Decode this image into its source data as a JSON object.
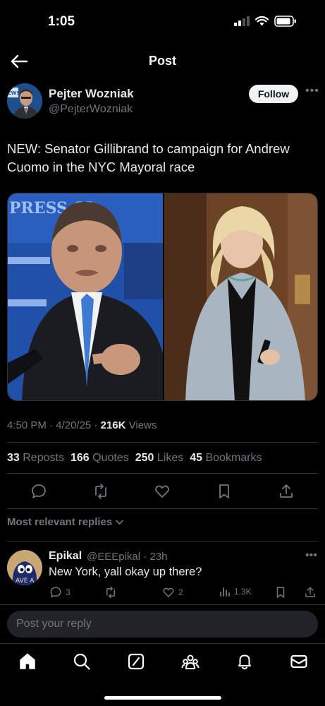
{
  "status_bar": {
    "time": "1:05"
  },
  "header": {
    "title": "Post"
  },
  "tweet": {
    "author_name": "Pejter Wozniak",
    "author_handle": "@PejterWozniak",
    "follow_label": "Follow",
    "text": "NEW: Senator Gillibrand to campaign for Andrew Cuomo in the NYC Mayoral race",
    "time": "4:50 PM",
    "date": "4/20/25",
    "views_count": "216K",
    "views_label": "Views",
    "avatar_text": "EWS",
    "media_left_text": "PRESS CL",
    "stats": {
      "reposts": "33",
      "reposts_label": "Reposts",
      "quotes": "166",
      "quotes_label": "Quotes",
      "likes": "250",
      "likes_label": "Likes",
      "bookmarks": "45",
      "bookmarks_label": "Bookmarks"
    }
  },
  "replies_filter": "Most relevant replies",
  "reply": {
    "name": "Epikal",
    "handle": "@EEEpikal",
    "age": "23h",
    "text": "New York, yall okay up there?",
    "avatar_text": "AVE A",
    "replies": "3",
    "likes": "2",
    "views": "1.3K"
  },
  "composer": {
    "placeholder": "Post your reply"
  },
  "colors": {
    "background": "#000000",
    "muted": "#71767b",
    "text": "#e7e9ea"
  },
  "icons": [
    "back-arrow-icon",
    "signal-icon",
    "wifi-icon",
    "battery-icon",
    "more-icon",
    "reply-icon",
    "repost-icon",
    "like-icon",
    "bookmark-icon",
    "share-icon",
    "views-icon",
    "chevron-down-icon",
    "home-icon",
    "search-icon",
    "grok-icon",
    "communities-icon",
    "notifications-icon",
    "messages-icon"
  ]
}
